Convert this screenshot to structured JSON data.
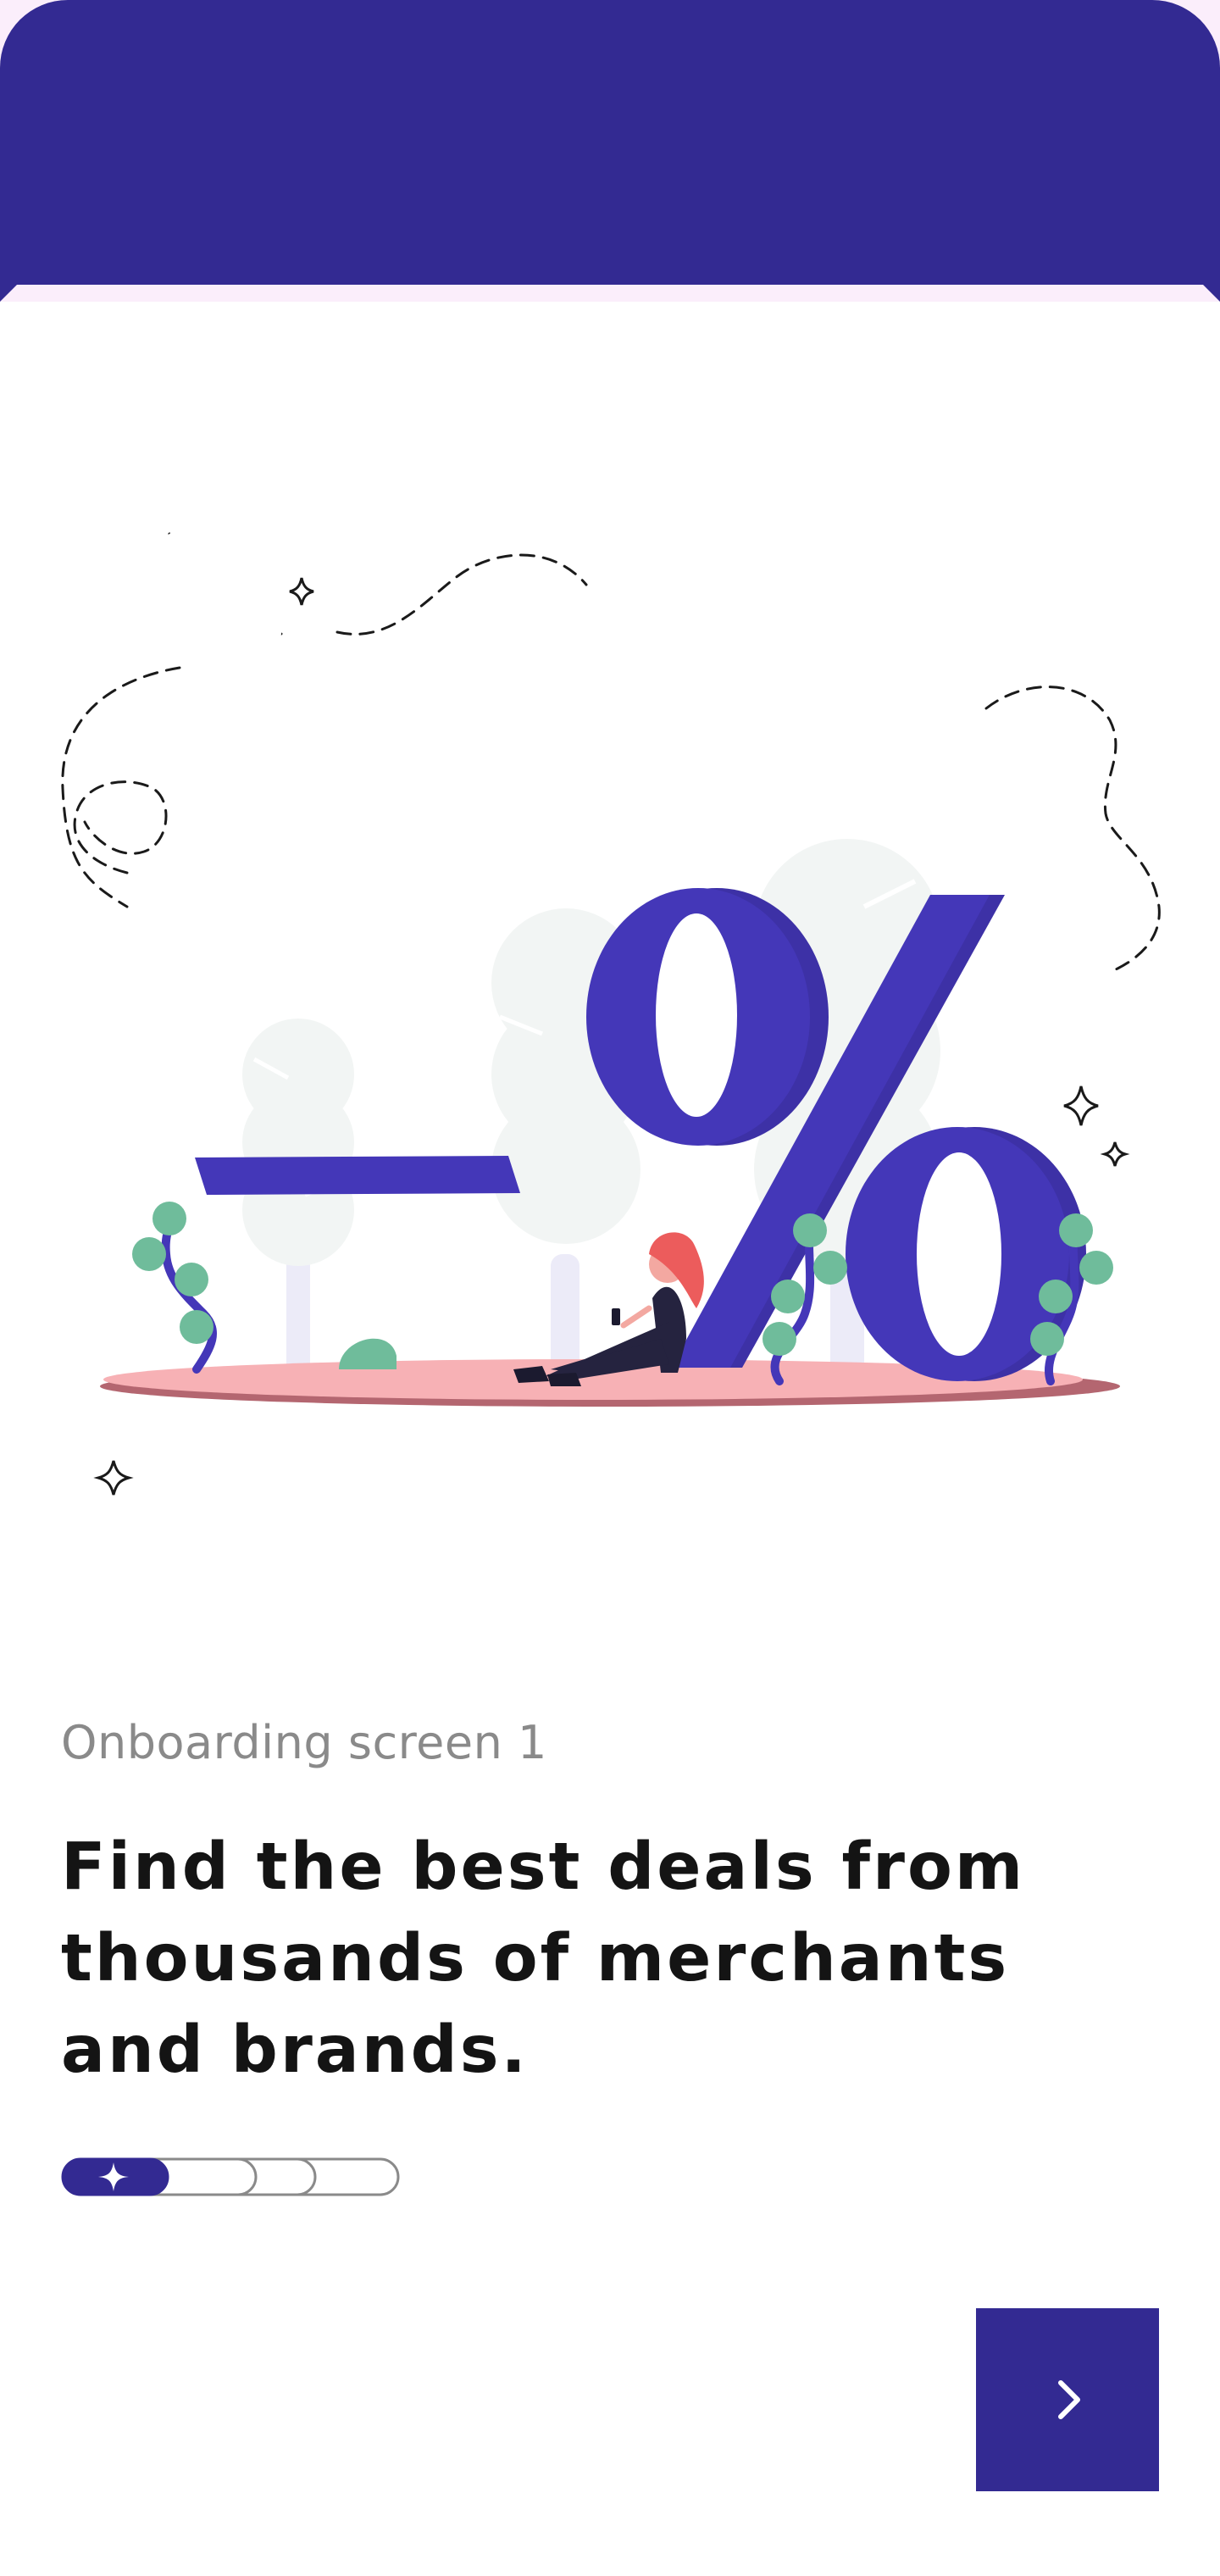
{
  "header": {
    "background_color": "#332a92",
    "accent_strip_color": "#fbeefb"
  },
  "illustration": {
    "name": "discount-percentage-illustration"
  },
  "onboarding": {
    "screen_label": "Onboarding screen 1",
    "headline_strong": "Find",
    "headline_rest": " the best deals from thousands of merchants and brands."
  },
  "pager": {
    "total_steps": 3,
    "current_step": 1,
    "active_color": "#332a92",
    "active_icon": "sparkle-icon"
  },
  "next_button": {
    "icon": "chevron-right-icon",
    "background_color": "#332a92"
  }
}
